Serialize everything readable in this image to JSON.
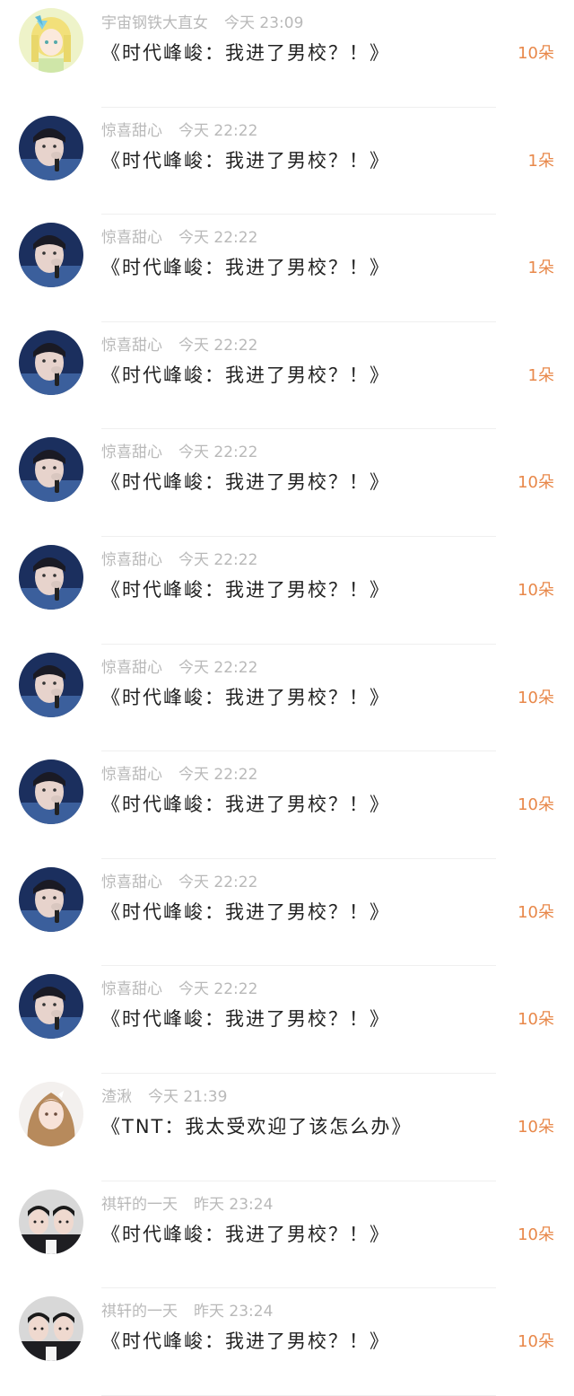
{
  "colors": {
    "meta_text": "#b9b9b9",
    "title_text": "#222222",
    "amount_text": "#e8884a",
    "divider": "#efefef"
  },
  "rows": [
    {
      "user": "宇宙钢铁大直女",
      "time": "今天 23:09",
      "title": "《时代峰峻：我进了男校？！》",
      "amount": "10朵",
      "avatar": "anime-girl-avatar"
    },
    {
      "user": "惊喜甜心",
      "time": "今天 22:22",
      "title": "《时代峰峻：我进了男校？！》",
      "amount": "1朵",
      "avatar": "boy-portrait-avatar"
    },
    {
      "user": "惊喜甜心",
      "time": "今天 22:22",
      "title": "《时代峰峻：我进了男校？！》",
      "amount": "1朵",
      "avatar": "boy-portrait-avatar"
    },
    {
      "user": "惊喜甜心",
      "time": "今天 22:22",
      "title": "《时代峰峻：我进了男校？！》",
      "amount": "1朵",
      "avatar": "boy-portrait-avatar"
    },
    {
      "user": "惊喜甜心",
      "time": "今天 22:22",
      "title": "《时代峰峻：我进了男校？！》",
      "amount": "10朵",
      "avatar": "boy-portrait-avatar"
    },
    {
      "user": "惊喜甜心",
      "time": "今天 22:22",
      "title": "《时代峰峻：我进了男校？！》",
      "amount": "10朵",
      "avatar": "boy-portrait-avatar"
    },
    {
      "user": "惊喜甜心",
      "time": "今天 22:22",
      "title": "《时代峰峻：我进了男校？！》",
      "amount": "10朵",
      "avatar": "boy-portrait-avatar"
    },
    {
      "user": "惊喜甜心",
      "time": "今天 22:22",
      "title": "《时代峰峻：我进了男校？！》",
      "amount": "10朵",
      "avatar": "boy-portrait-avatar"
    },
    {
      "user": "惊喜甜心",
      "time": "今天 22:22",
      "title": "《时代峰峻：我进了男校？！》",
      "amount": "10朵",
      "avatar": "boy-portrait-avatar"
    },
    {
      "user": "惊喜甜心",
      "time": "今天 22:22",
      "title": "《时代峰峻：我进了男校？！》",
      "amount": "10朵",
      "avatar": "boy-portrait-avatar"
    },
    {
      "user": "渣湫",
      "time": "今天 21:39",
      "title": "《TNT：我太受欢迎了该怎么办》",
      "amount": "10朵",
      "avatar": "girl-portrait-avatar"
    },
    {
      "user": "祺轩的一天",
      "time": "昨天 23:24",
      "title": "《时代峰峻：我进了男校？！》",
      "amount": "10朵",
      "avatar": "two-boys-avatar"
    },
    {
      "user": "祺轩的一天",
      "time": "昨天 23:24",
      "title": "《时代峰峻：我进了男校？！》",
      "amount": "10朵",
      "avatar": "two-boys-avatar"
    }
  ]
}
